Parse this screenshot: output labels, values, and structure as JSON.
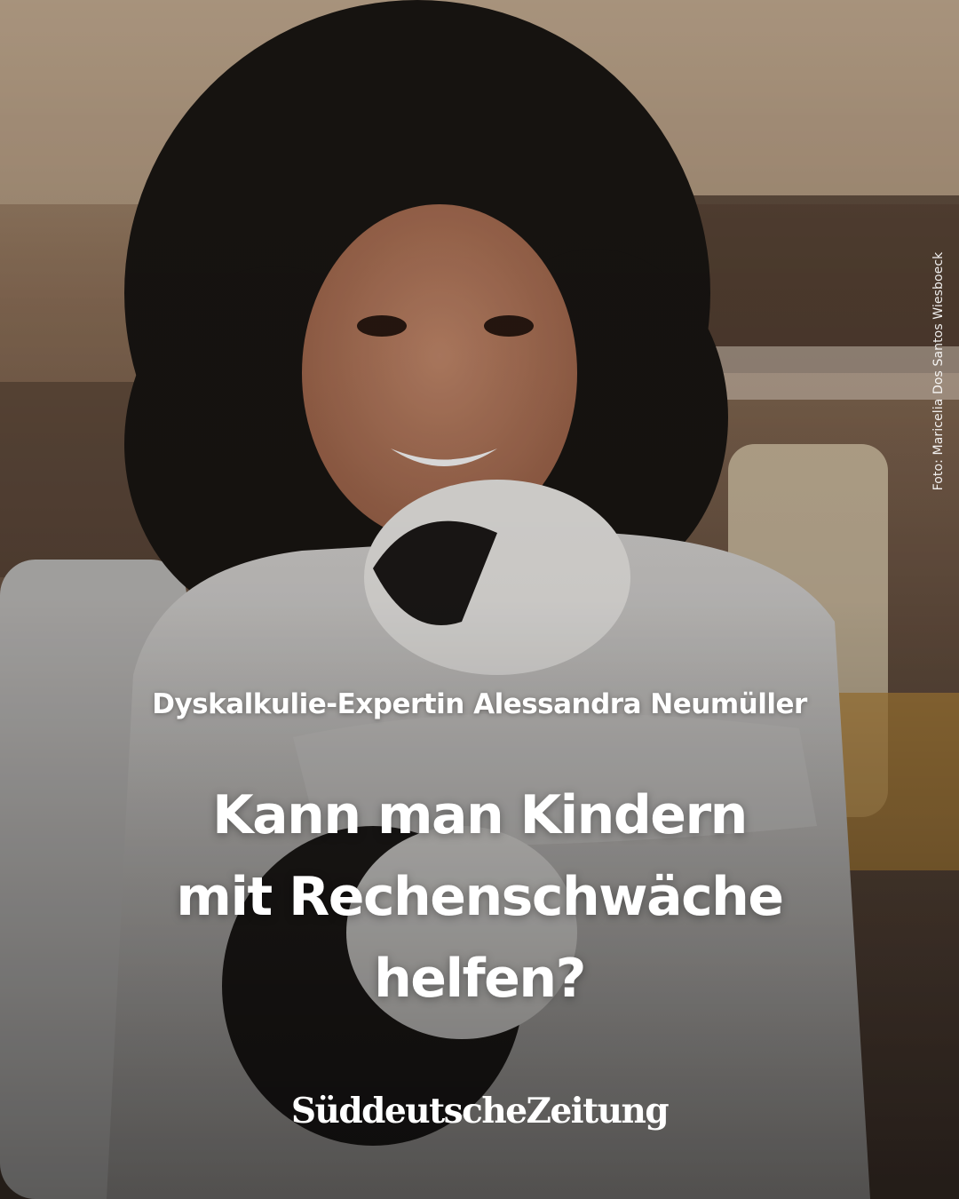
{
  "photo": {
    "subject": "woman-with-curly-hair-holding-black-and-white-cat"
  },
  "credit": "Foto: Maricelia Dos Santos Wiesboeck",
  "kicker": "Dyskalkulie-Expertin Alessandra Neumüller",
  "headline": {
    "lines": [
      "Kann man Kindern",
      "mit Rechenschwäche",
      "helfen?"
    ]
  },
  "brand": {
    "logo_text": "SüddeutscheZeitung"
  },
  "colors": {
    "text": "#ffffff",
    "background_warm": "#8a6a4e"
  }
}
